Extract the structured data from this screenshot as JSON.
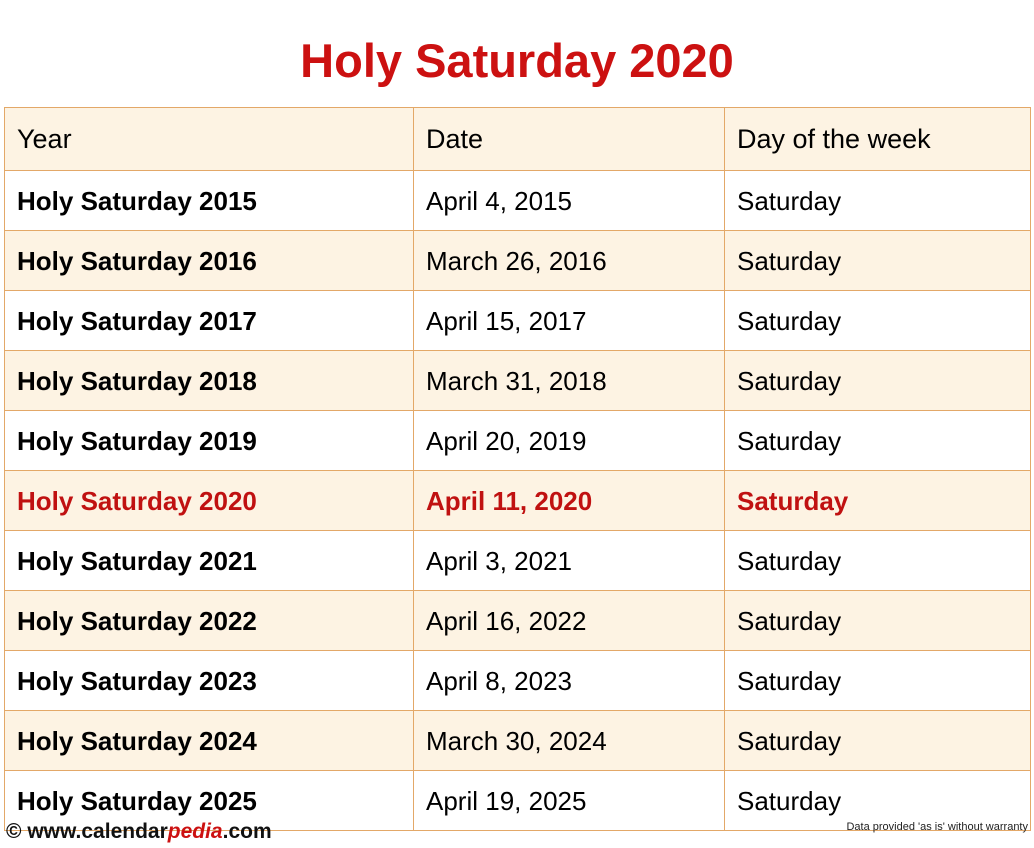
{
  "title": "Holy Saturday 2020",
  "table": {
    "headers": [
      "Year",
      "Date",
      "Day of the week"
    ],
    "rows": [
      {
        "year": "Holy Saturday 2015",
        "date": "April 4, 2015",
        "dow": "Saturday",
        "highlight": false
      },
      {
        "year": "Holy Saturday 2016",
        "date": "March 26, 2016",
        "dow": "Saturday",
        "highlight": false
      },
      {
        "year": "Holy Saturday 2017",
        "date": "April 15, 2017",
        "dow": "Saturday",
        "highlight": false
      },
      {
        "year": "Holy Saturday 2018",
        "date": "March 31, 2018",
        "dow": "Saturday",
        "highlight": false
      },
      {
        "year": "Holy Saturday 2019",
        "date": "April 20, 2019",
        "dow": "Saturday",
        "highlight": false
      },
      {
        "year": "Holy Saturday 2020",
        "date": "April 11, 2020",
        "dow": "Saturday",
        "highlight": true
      },
      {
        "year": "Holy Saturday 2021",
        "date": "April 3, 2021",
        "dow": "Saturday",
        "highlight": false
      },
      {
        "year": "Holy Saturday 2022",
        "date": "April 16, 2022",
        "dow": "Saturday",
        "highlight": false
      },
      {
        "year": "Holy Saturday 2023",
        "date": "April 8, 2023",
        "dow": "Saturday",
        "highlight": false
      },
      {
        "year": "Holy Saturday 2024",
        "date": "March 30, 2024",
        "dow": "Saturday",
        "highlight": false
      },
      {
        "year": "Holy Saturday 2025",
        "date": "April 19, 2025",
        "dow": "Saturday",
        "highlight": false
      }
    ]
  },
  "footer": {
    "copyright_symbol": "©",
    "site_prefix": " www.calendar",
    "site_brand": "pedia",
    "site_suffix": ".com",
    "disclaimer": "Data provided 'as is' without warranty"
  },
  "colors": {
    "accent_red": "#cc1111",
    "border_tan": "#e3a868",
    "row_cream": "#fdf3e3",
    "row_white": "#ffffff"
  }
}
